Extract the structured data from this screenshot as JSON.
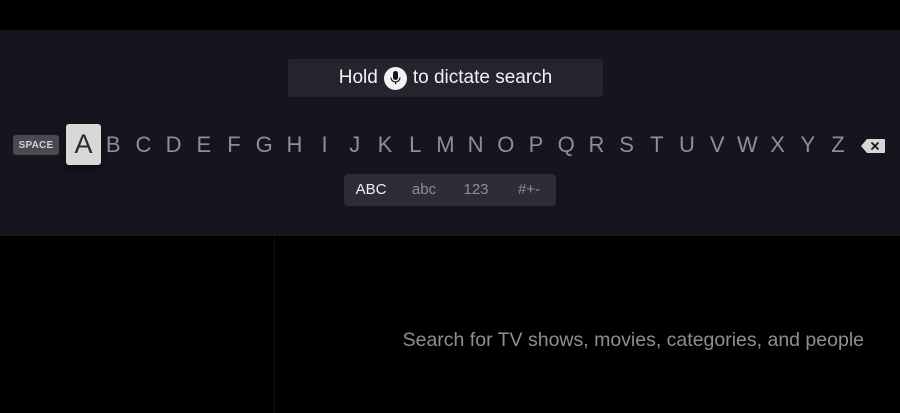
{
  "dictate": {
    "prefix": "Hold",
    "suffix": "to dictate search",
    "icon": "microphone-icon"
  },
  "keyboard": {
    "space_label": "SPACE",
    "letters": [
      "A",
      "B",
      "C",
      "D",
      "E",
      "F",
      "G",
      "H",
      "I",
      "J",
      "K",
      "L",
      "M",
      "N",
      "O",
      "P",
      "Q",
      "R",
      "S",
      "T",
      "U",
      "V",
      "W",
      "X",
      "Y",
      "Z"
    ],
    "focused_letter": "A",
    "delete_icon": "backspace-icon"
  },
  "modes": {
    "items": [
      "ABC",
      "abc",
      "123",
      "#+-"
    ],
    "active": "ABC"
  },
  "results": {
    "hint": "Search for TV shows, movies, categories, and people"
  },
  "colors": {
    "panel": "#16151f",
    "background": "#000000",
    "focus": "#d8d8d8",
    "text_dim": "#8e8e96",
    "text_bright": "#f2f2f2"
  }
}
